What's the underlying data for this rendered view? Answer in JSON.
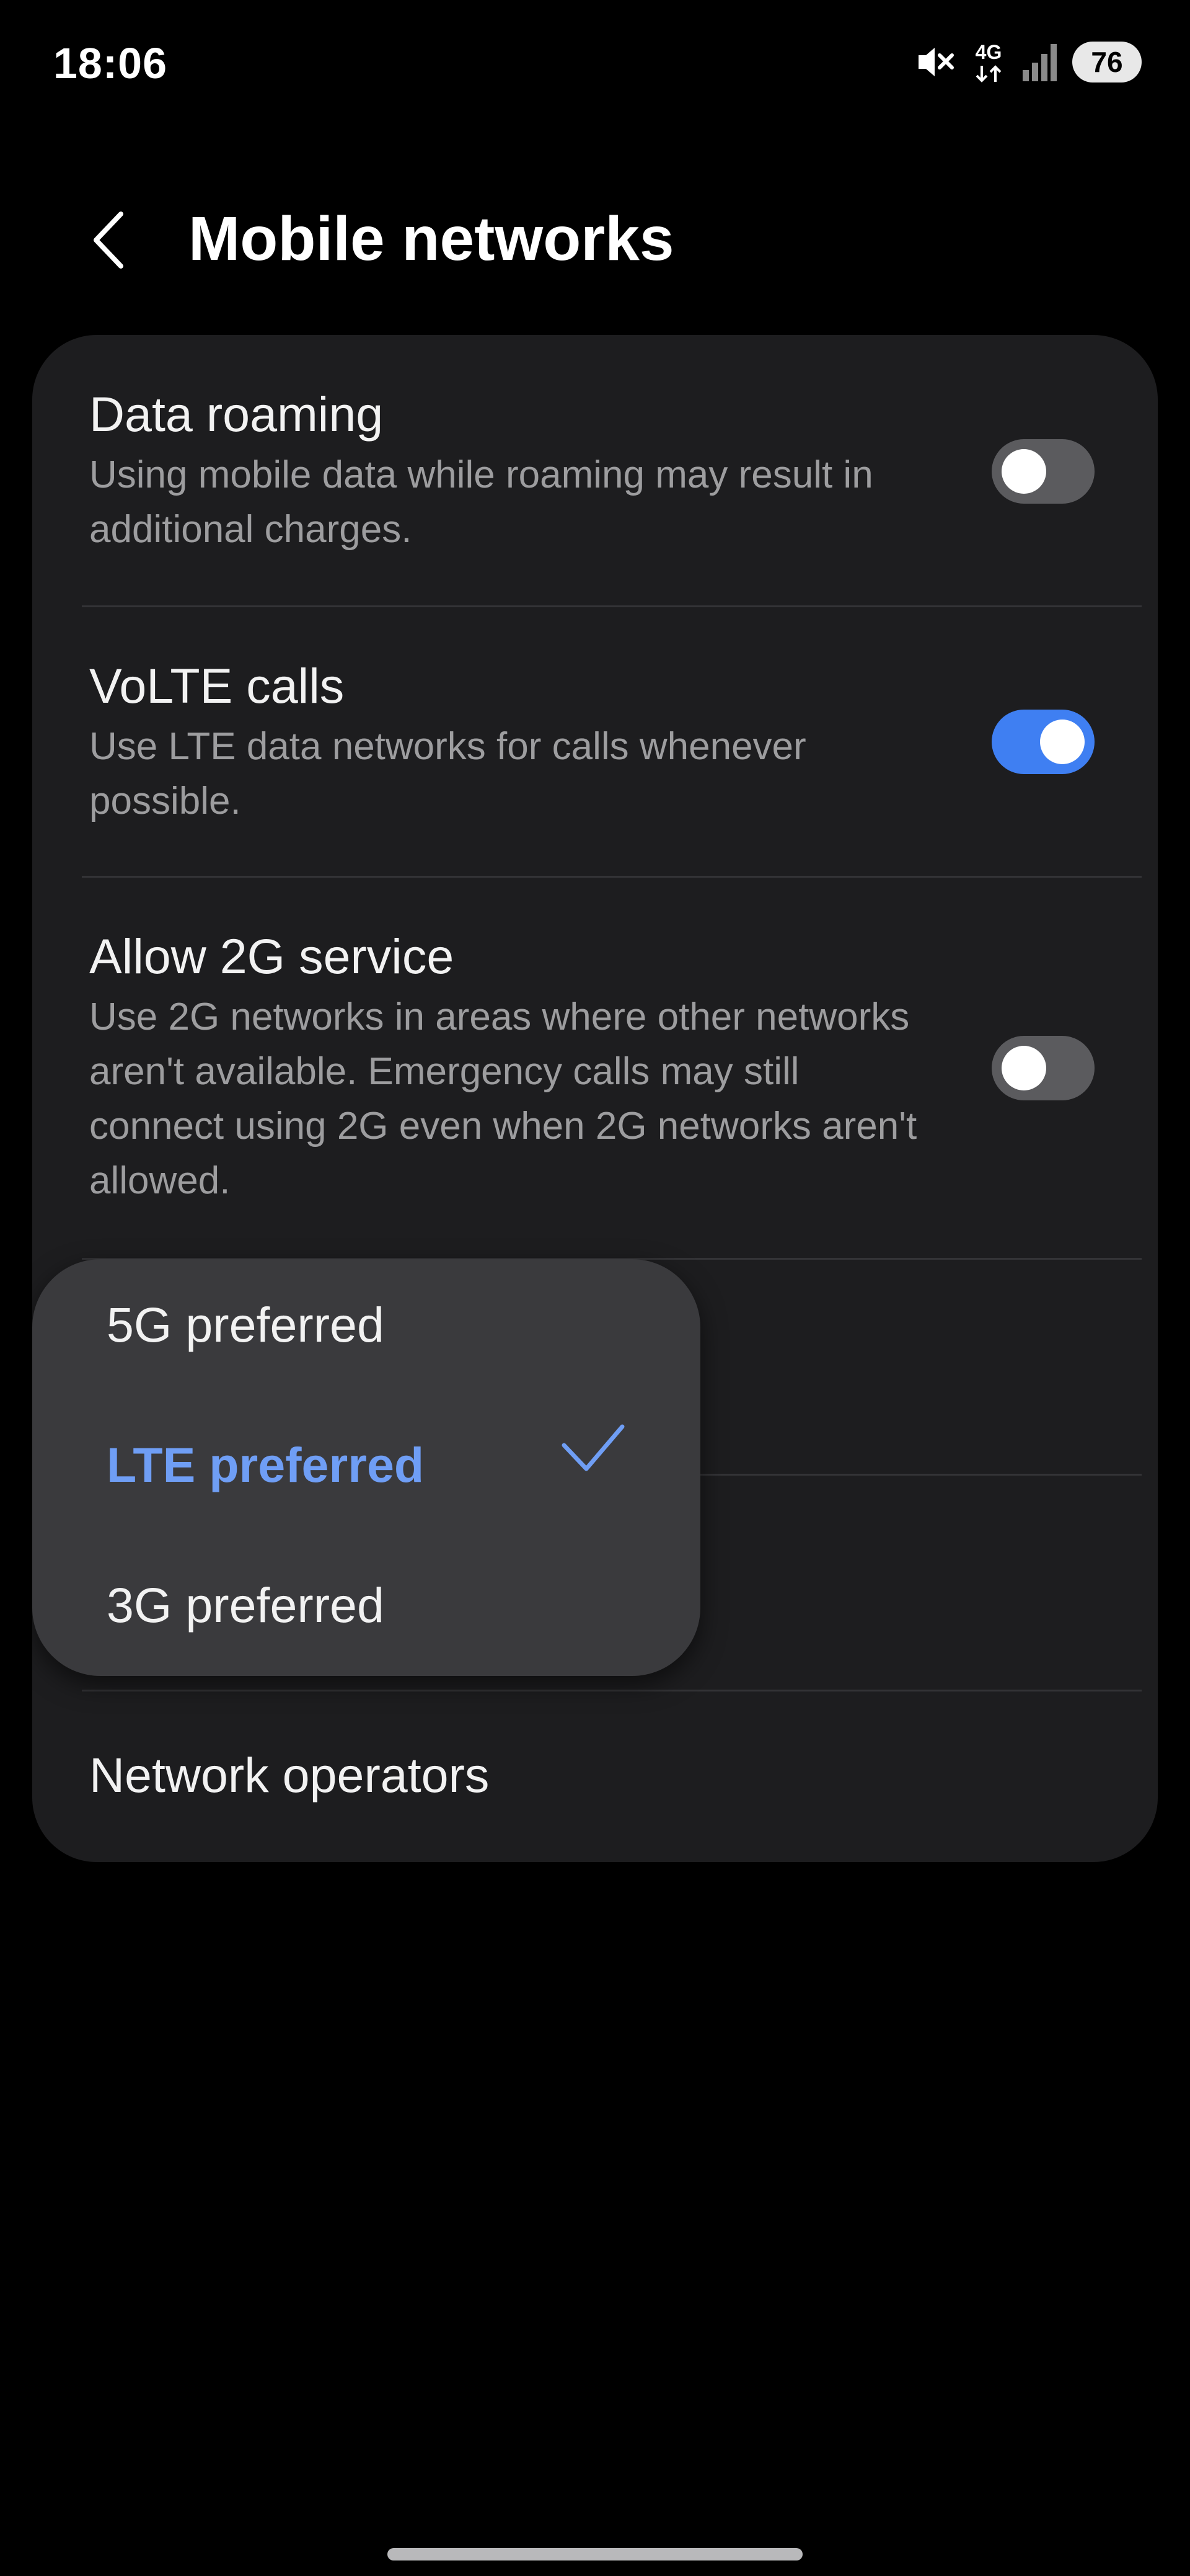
{
  "status_bar": {
    "time": "18:06",
    "network_type": "4G",
    "battery_level": "76",
    "icons": [
      "mute-icon",
      "network-4g-icon",
      "signal-icon",
      "battery-icon"
    ]
  },
  "header": {
    "back_icon": "chevron-left-icon",
    "title": "Mobile networks"
  },
  "settings": [
    {
      "title": "Data roaming",
      "description": "Using mobile data while roaming may result in additional charges.",
      "toggle": false
    },
    {
      "title": "VoLTE calls",
      "description": "Use LTE data networks for calls whenever possible.",
      "toggle": true
    },
    {
      "title": "Allow 2G service",
      "description": "Use 2G networks in areas where other networks aren't available. Emergency calls may still connect using 2G even when 2G networks aren't allowed.",
      "toggle": false
    },
    {
      "title": "Network operators"
    }
  ],
  "network_mode_menu": {
    "options": [
      "5G preferred",
      "LTE preferred",
      "3G preferred"
    ],
    "selected": "LTE preferred",
    "check_icon": "checkmark-icon"
  },
  "colors": {
    "background": "#000000",
    "card": "#1d1d1f",
    "menu": "#3a3a3d",
    "accent": "#3f7ff2",
    "selected_text": "#6f9ef5",
    "toggle_off": "#5b5b5e",
    "secondary_text": "#9d9d9f"
  }
}
